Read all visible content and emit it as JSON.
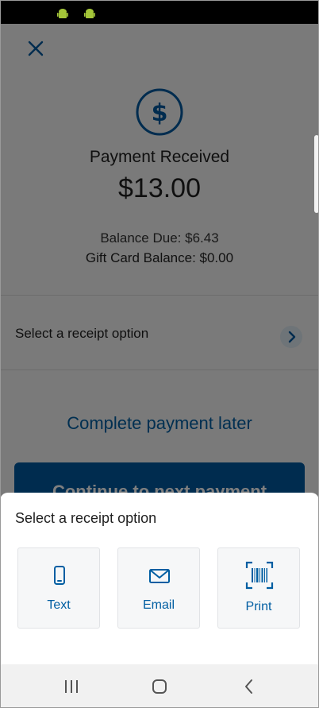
{
  "screen": {
    "title": "Payment Received",
    "amount": "$13.00",
    "balance_due": "Balance Due: $6.43",
    "gift_card_balance": "Gift Card Balance: $0.00",
    "receipt_row_label": "Select a receipt option",
    "complete_later": "Complete payment later",
    "continue_button": "Continue to next payment"
  },
  "sheet": {
    "title": "Select a receipt option",
    "options": [
      {
        "label": "Text",
        "icon": "phone-icon"
      },
      {
        "label": "Email",
        "icon": "envelope-icon"
      },
      {
        "label": "Print",
        "icon": "barcode-icon"
      }
    ]
  },
  "colors": {
    "accent": "#005ea2",
    "button": "#00599f",
    "android": "#a4c639"
  }
}
